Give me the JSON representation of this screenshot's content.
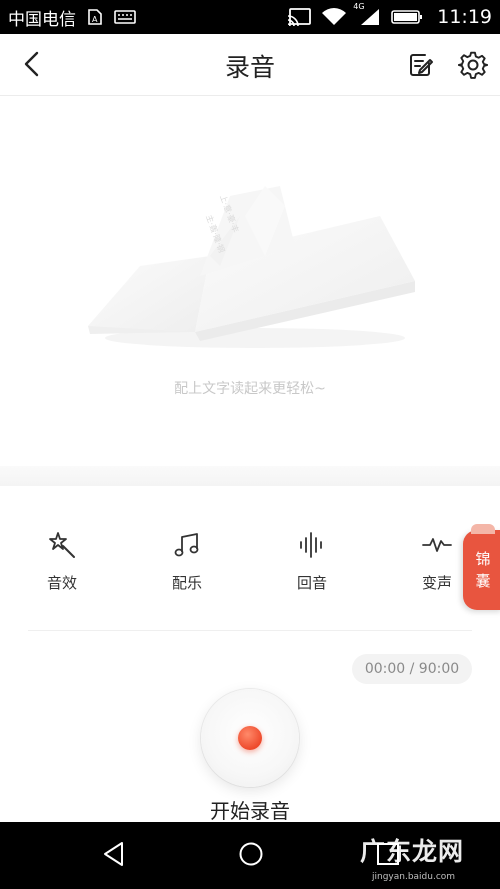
{
  "status_bar": {
    "carrier": "中国电信",
    "network": "4G",
    "time": "11:19"
  },
  "header": {
    "title": "录音",
    "icons": [
      "back-arrow-icon",
      "edit-text-icon",
      "gear-icon"
    ]
  },
  "empty_state": {
    "hint": "配上文字读起来更轻松~"
  },
  "tools": [
    {
      "label": "音效",
      "icon": "magic-wand-icon"
    },
    {
      "label": "配乐",
      "icon": "music-note-icon"
    },
    {
      "label": "回音",
      "icon": "waveform-icon"
    },
    {
      "label": "变声",
      "icon": "pulse-icon"
    }
  ],
  "side_tab": {
    "line1": "锦",
    "line2": "囊"
  },
  "recorder": {
    "timer": "00:00 / 90:00",
    "button_label": "开始录音"
  },
  "watermark": {
    "text": "广东龙网",
    "sub": "jingyan.baidu.com"
  },
  "colors": {
    "accent": "#ee4a2c",
    "side_tab": "#e8553f",
    "bar_bg": "#000000"
  }
}
